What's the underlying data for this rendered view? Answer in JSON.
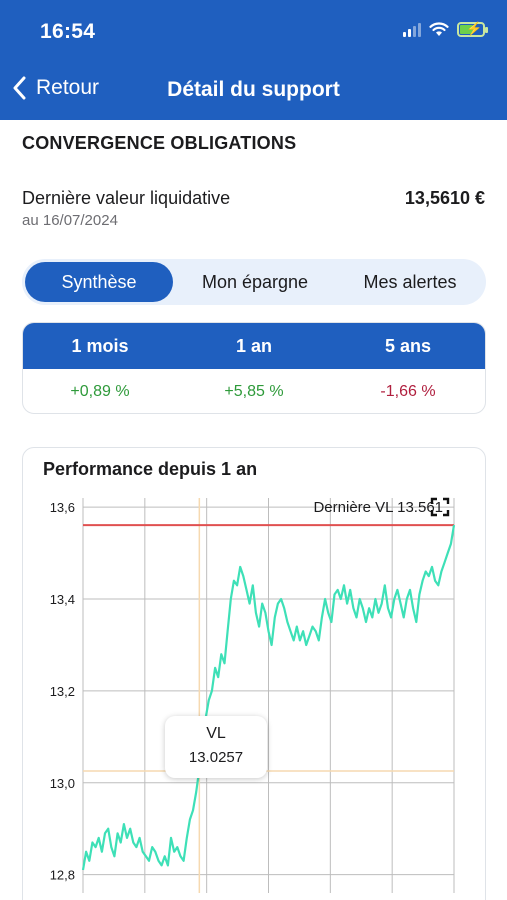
{
  "status_bar": {
    "time": "16:54"
  },
  "nav": {
    "back_label": "Retour",
    "title": "Détail du support"
  },
  "fund": {
    "name": "CONVERGENCE OBLIGATIONS",
    "vl_label": "Dernière valeur liquidative",
    "vl_date": "au 16/07/2024",
    "vl_value": "13,5610 €"
  },
  "tabs": [
    {
      "label": "Synthèse",
      "active": true
    },
    {
      "label": "Mon épargne",
      "active": false
    },
    {
      "label": "Mes alertes",
      "active": false
    }
  ],
  "performance": {
    "headers": [
      "1 mois",
      "1 an",
      "5 ans"
    ],
    "values": [
      "+0,89 %",
      "+5,85 %",
      "-1,66 %"
    ]
  },
  "colors": {
    "primary": "#1f5fbf",
    "positive": "#2e9a3a",
    "negative": "#b01f3e",
    "series": "#3ee0b7",
    "last_vl_line": "#e05050",
    "crosshair": "#f6d9b0"
  },
  "icons": {
    "back": "chevron-left-icon",
    "expand": "expand-icon"
  },
  "chart_data": {
    "type": "line",
    "title": "Performance depuis 1 an",
    "ylim": [
      12.76,
      13.62
    ],
    "yticks": [
      "13,6",
      "13,4",
      "13,2",
      "13,0",
      "12,8"
    ],
    "ytick_values": [
      13.6,
      13.4,
      13.2,
      13.0,
      12.8
    ],
    "grid": true,
    "reference_line": {
      "label": "Dernière VL 13.561",
      "value": 13.561
    },
    "tooltip": {
      "label": "VL",
      "value": "13.0257",
      "y": 13.0257,
      "x_index": 37
    },
    "series": [
      {
        "values": [
          12.81,
          12.85,
          12.83,
          12.87,
          12.86,
          12.88,
          12.85,
          12.89,
          12.9,
          12.86,
          12.84,
          12.89,
          12.87,
          12.91,
          12.88,
          12.9,
          12.87,
          12.86,
          12.88,
          12.85,
          12.84,
          12.83,
          12.86,
          12.85,
          12.83,
          12.82,
          12.84,
          12.82,
          12.88,
          12.85,
          12.86,
          12.84,
          12.83,
          12.88,
          12.92,
          12.94,
          12.98,
          13.03,
          13.09,
          13.14,
          13.18,
          13.2,
          13.25,
          13.23,
          13.28,
          13.26,
          13.33,
          13.4,
          13.44,
          13.43,
          13.47,
          13.45,
          13.42,
          13.39,
          13.43,
          13.37,
          13.34,
          13.39,
          13.37,
          13.33,
          13.3,
          13.36,
          13.39,
          13.4,
          13.38,
          13.35,
          13.33,
          13.31,
          13.34,
          13.31,
          13.33,
          13.3,
          13.32,
          13.34,
          13.33,
          13.31,
          13.36,
          13.4,
          13.37,
          13.35,
          13.41,
          13.42,
          13.4,
          13.43,
          13.39,
          13.42,
          13.38,
          13.36,
          13.4,
          13.38,
          13.35,
          13.38,
          13.36,
          13.4,
          13.37,
          13.39,
          13.43,
          13.38,
          13.36,
          13.4,
          13.42,
          13.39,
          13.36,
          13.4,
          13.42,
          13.38,
          13.35,
          13.41,
          13.44,
          13.46,
          13.45,
          13.47,
          13.44,
          13.43,
          13.46,
          13.48,
          13.5,
          13.52,
          13.561
        ]
      }
    ]
  }
}
